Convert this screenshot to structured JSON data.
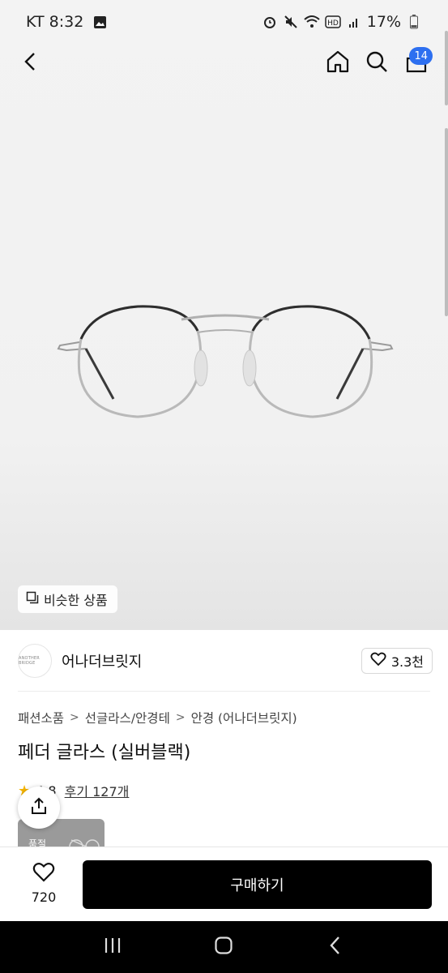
{
  "status_bar": {
    "carrier_time": "KT 8:32",
    "battery": "17%",
    "icons": [
      "gallery-icon",
      "alarm-icon",
      "mute-icon",
      "wifi-icon",
      "hd-icon",
      "signal-icon",
      "battery-icon"
    ]
  },
  "top_nav": {
    "cart_count": "14",
    "icons": [
      "back-icon",
      "home-icon",
      "search-icon",
      "cart-icon"
    ],
    "badge_color": "#2d6ff0"
  },
  "hero": {
    "similar_label": "비슷한 상품"
  },
  "brand": {
    "logo_text": "ANOTHER BRIDGE",
    "name": "어나더브릿지",
    "like_count": "3.3천"
  },
  "breadcrumb": [
    "패션소품",
    "선글라스/안경테",
    "안경 (어나더브릿지)"
  ],
  "product": {
    "title": "페더 글라스 (실버블랙)",
    "rating": "4.8",
    "review_label": "후기 127개",
    "sold_out_label": "품절"
  },
  "bottom_bar": {
    "wish_count": "720",
    "buy_label": "구매하기"
  },
  "colors": {
    "accent": "#2d6ff0",
    "buy_button": "#000000",
    "star": "#f5b400"
  }
}
